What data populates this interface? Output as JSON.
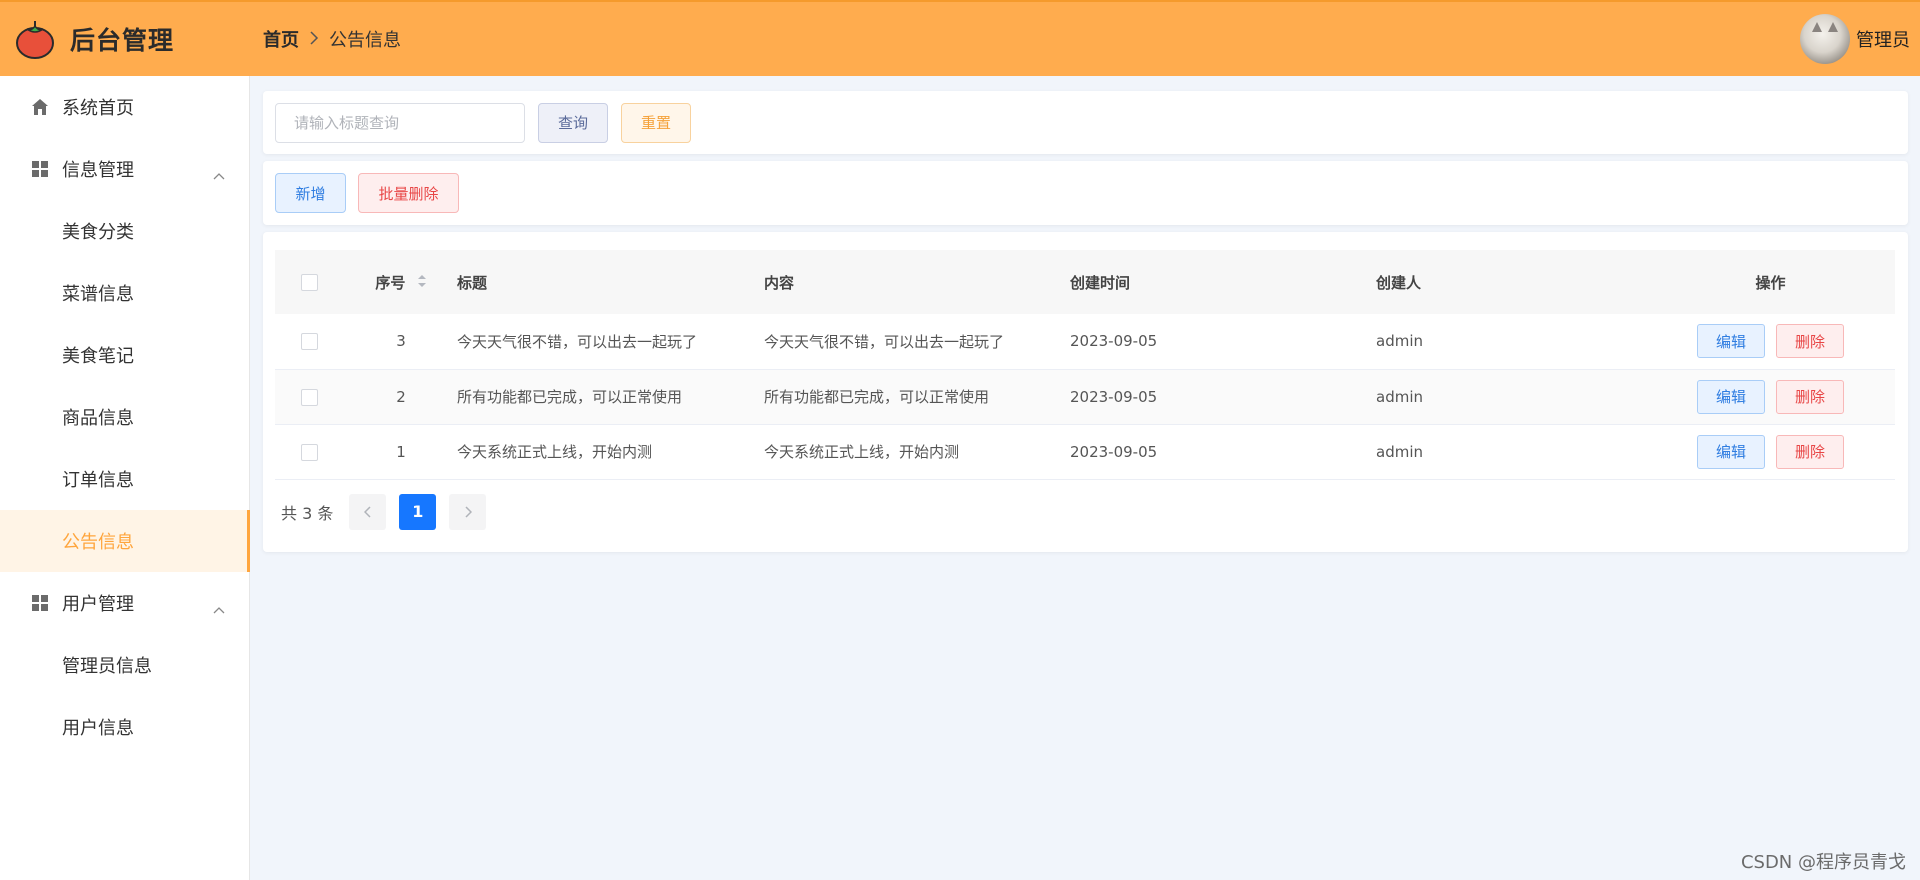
{
  "app": {
    "title": "后台管理",
    "logo_icon": "tomato-icon"
  },
  "breadcrumb": {
    "home": "首页",
    "current": "公告信息"
  },
  "user": {
    "name": "管理员"
  },
  "sidebar": {
    "items": [
      {
        "label": "系统首页",
        "icon": "home-icon"
      },
      {
        "label": "信息管理",
        "icon": "grid-icon"
      },
      {
        "label": "美食分类"
      },
      {
        "label": "菜谱信息"
      },
      {
        "label": "美食笔记"
      },
      {
        "label": "商品信息"
      },
      {
        "label": "订单信息"
      },
      {
        "label": "公告信息",
        "active": true
      },
      {
        "label": "用户管理",
        "icon": "grid-icon"
      },
      {
        "label": "管理员信息"
      },
      {
        "label": "用户信息"
      }
    ]
  },
  "search": {
    "placeholder": "请输入标题查询",
    "value": "",
    "query_label": "查询",
    "reset_label": "重置"
  },
  "actions": {
    "add_label": "新增",
    "batch_delete_label": "批量删除"
  },
  "table": {
    "headers": {
      "index": "序号",
      "title": "标题",
      "content": "内容",
      "created_at": "创建时间",
      "creator": "创建人",
      "ops": "操作"
    },
    "rows": [
      {
        "index": "3",
        "title": "今天天气很不错，可以出去一起玩了",
        "content": "今天天气很不错，可以出去一起玩了",
        "created_at": "2023-09-05",
        "creator": "admin"
      },
      {
        "index": "2",
        "title": "所有功能都已完成，可以正常使用",
        "content": "所有功能都已完成，可以正常使用",
        "created_at": "2023-09-05",
        "creator": "admin"
      },
      {
        "index": "1",
        "title": "今天系统正式上线，开始内测",
        "content": "今天系统正式上线，开始内测",
        "created_at": "2023-09-05",
        "creator": "admin"
      }
    ],
    "edit_label": "编辑",
    "delete_label": "删除"
  },
  "pagination": {
    "total_text": "共 3 条",
    "current_page": "1"
  },
  "watermark": "CSDN @程序员青戈",
  "colors": {
    "header_bg": "#ffac4e",
    "accent": "#ffa53d",
    "primary": "#1677ff",
    "danger": "#e84646"
  }
}
